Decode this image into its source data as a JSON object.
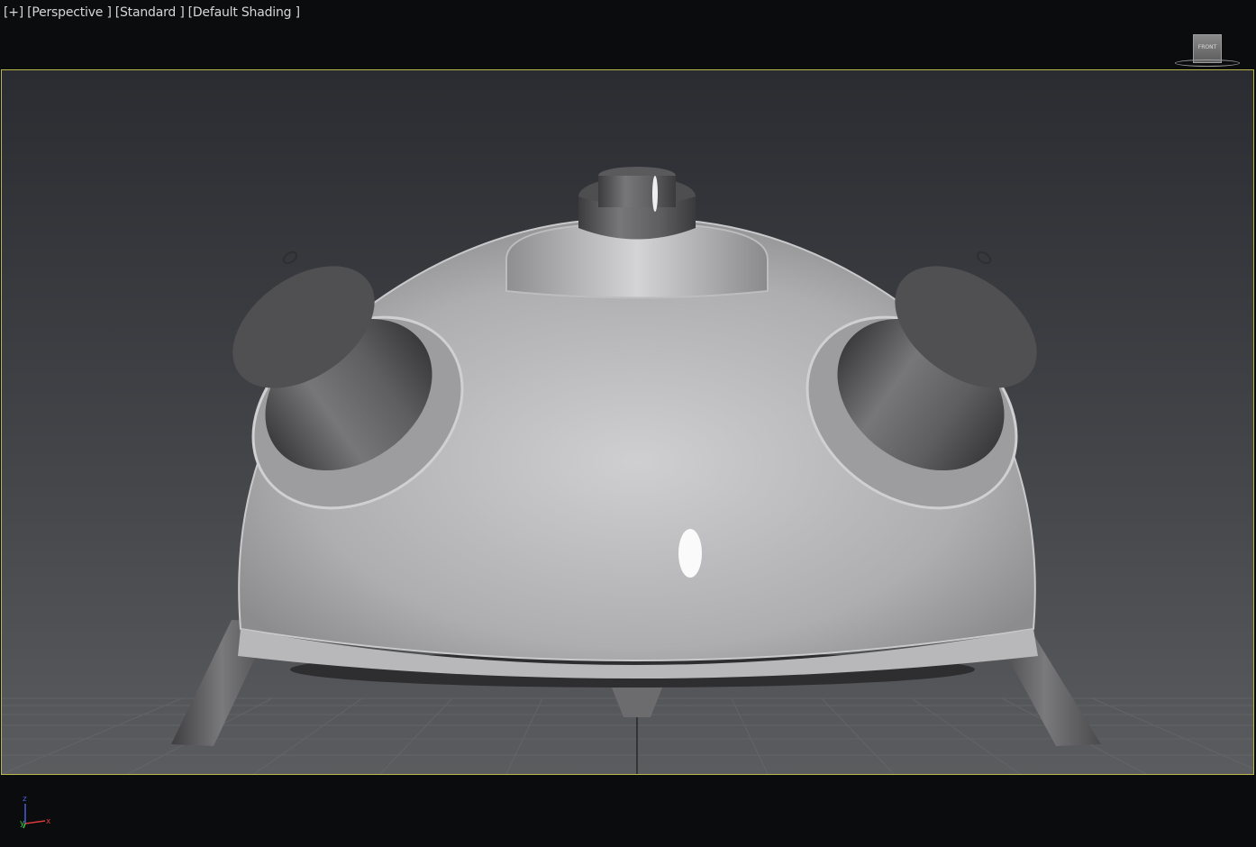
{
  "viewport": {
    "label_plus": "[+]",
    "label_view": "[Perspective ]",
    "label_preset": "[Standard ]",
    "label_shading": "[Default Shading ]"
  },
  "viewcube": {
    "face_label": "FRONT"
  },
  "axis_gizmo": {
    "z_label": "z",
    "y_label": "y",
    "x_label": "x",
    "z_color": "#4a5cd8",
    "y_color": "#3fc44a",
    "x_color": "#d83a3a"
  },
  "colors": {
    "viewport_border": "#b9b84a",
    "background_top": "#2a2c31",
    "background_bottom": "#5a5b5e"
  }
}
